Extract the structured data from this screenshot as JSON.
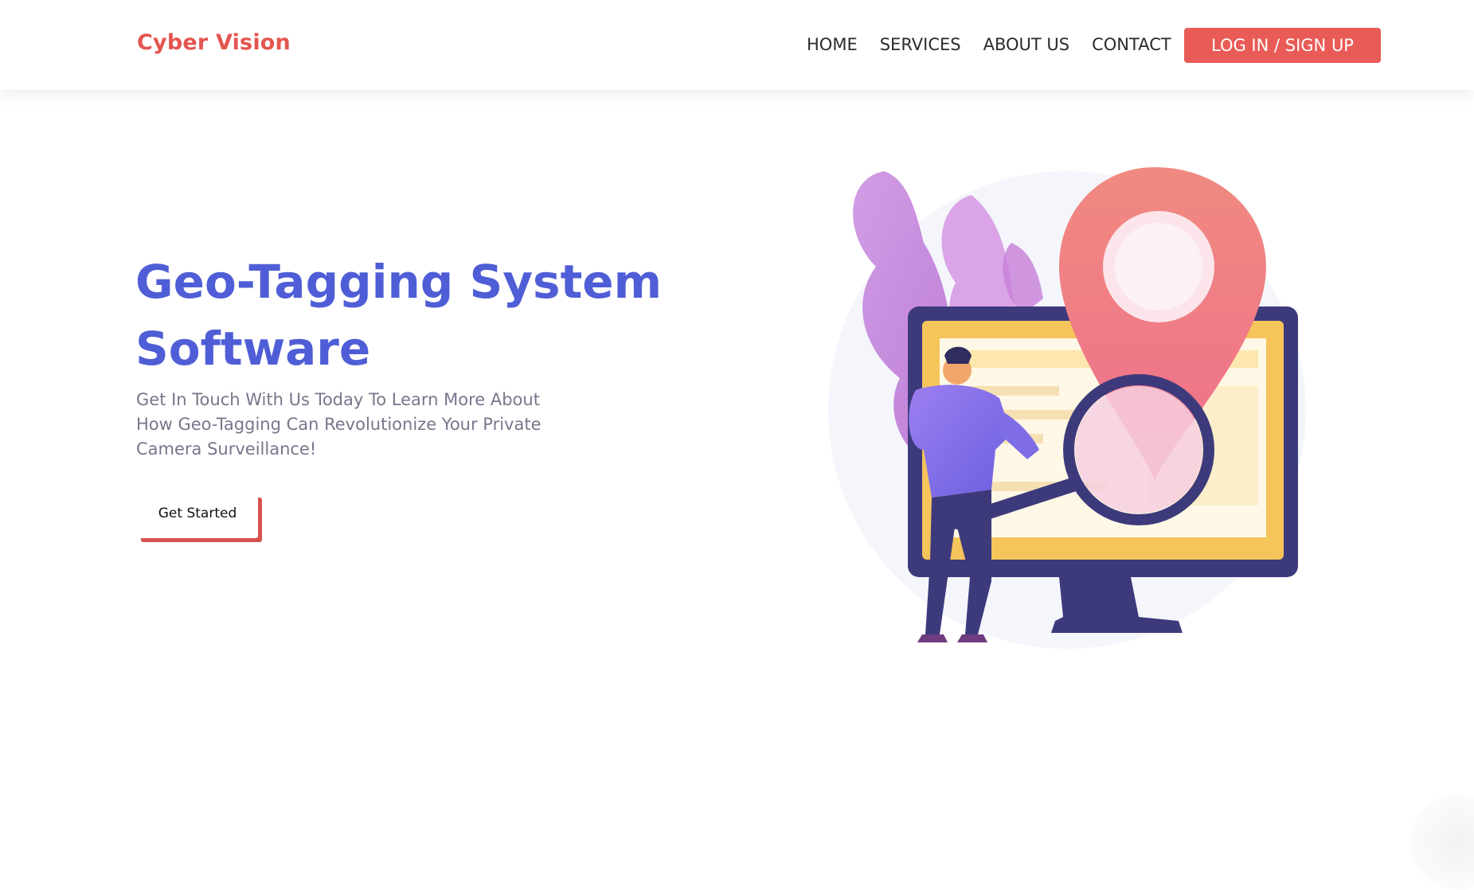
{
  "header": {
    "brand": "Cyber Vision",
    "nav": [
      "HOME",
      "SERVICES",
      "ABOUT US",
      "CONTACT"
    ],
    "login_label": "LOG IN / SIGN UP"
  },
  "hero": {
    "title": "Geo-Tagging System Software",
    "subtitle": "Get In Touch With Us Today To Learn More About How Geo-Tagging Can Revolutionize Your Private Camera Surveillance!",
    "cta_label": "Get Started"
  },
  "colors": {
    "brand": "#e4554f",
    "title": "#4f5ed6",
    "button": "#e95b56",
    "cta_shadow": "#d6534d",
    "subtitle": "#77768c"
  },
  "icons": {
    "illustration": "geo-location-illustration"
  }
}
